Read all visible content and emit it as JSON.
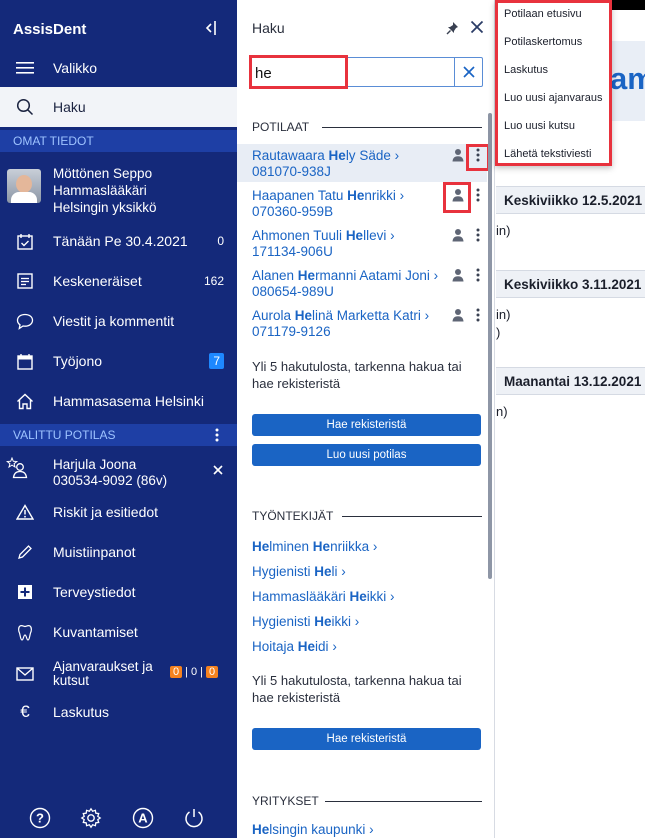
{
  "app": {
    "name": "AssisDent"
  },
  "sidebar": {
    "menu_label": "Valikko",
    "search_label": "Haku",
    "section_own": "OMAT TIEDOT",
    "user": {
      "name": "Möttönen Seppo",
      "role": "Hammaslääkäri",
      "unit": "Helsingin yksikkö"
    },
    "items": [
      {
        "label": "Tänään Pe 30.4.2021",
        "count": "0"
      },
      {
        "label": "Keskeneräiset",
        "count": "162"
      },
      {
        "label": "Viestit ja kommentit",
        "count": ""
      },
      {
        "label": "Työjono",
        "count": "7"
      },
      {
        "label": "Hammasasema Helsinki",
        "count": ""
      }
    ],
    "section_patient": "VALITTU POTILAS",
    "patient": {
      "name": "Harjula Joona",
      "ssn": "030534-9092 (86v)"
    },
    "patient_items": [
      {
        "label": "Riskit ja esitiedot"
      },
      {
        "label": "Muistiinpanot"
      },
      {
        "label": "Terveystiedot"
      },
      {
        "label": "Kuvantamiset"
      },
      {
        "label_line1": "Ajanvaraukset ja",
        "label_line2": "kutsut",
        "badges": [
          "0",
          "0",
          "0"
        ]
      },
      {
        "label": "Laskutus"
      }
    ]
  },
  "search": {
    "title": "Haku",
    "query": "he",
    "patients_header": "POTILAAT",
    "patients": [
      {
        "pre": "Rautawaara ",
        "hl": "He",
        "post": "ly Säde",
        "ssn": "081070-938J"
      },
      {
        "pre": "Haapanen Tatu ",
        "hl": "He",
        "post": "nrikki",
        "ssn": "070360-959B"
      },
      {
        "pre": "Ahmonen Tuuli ",
        "hl": "He",
        "post": "llevi",
        "ssn": "171134-906U"
      },
      {
        "pre": "Alanen ",
        "hl": "He",
        "post": "rmanni Aatami Joni",
        "ssn": "080654-989U"
      },
      {
        "pre": "Aurola ",
        "hl": "He",
        "post": "linä Marketta Katri",
        "ssn": "071179-9126"
      }
    ],
    "more_results_text": "Yli 5 hakutulosta, tarkenna hakua tai hae rekisteristä",
    "search_registry_btn": "Hae rekisteristä",
    "new_patient_btn": "Luo uusi potilas",
    "employees_header": "TYÖNTEKIJÄT",
    "employees": [
      {
        "a": "",
        "b": "He",
        "c": "lminen ",
        "d": "He",
        "e": "nriikka"
      },
      {
        "a": "Hygienisti ",
        "b": "He",
        "c": "li",
        "d": "",
        "e": ""
      },
      {
        "a": "Hammaslääkäri ",
        "b": "He",
        "c": "ikki",
        "d": "",
        "e": ""
      },
      {
        "a": "Hygienisti ",
        "b": "He",
        "c": "ikki",
        "d": "",
        "e": ""
      },
      {
        "a": "Hoitaja ",
        "b": "He",
        "c": "idi",
        "d": "",
        "e": ""
      }
    ],
    "more_results_text_2": "Yli 5 hakutulosta, tarkenna hakua tai hae rekisteristä",
    "search_registry_btn_2": "Hae rekisteristä",
    "companies_header": "YRITYKSET",
    "companies": [
      {
        "pre": "",
        "hl": "He",
        "post": "lsingin kaupunki"
      }
    ]
  },
  "context_menu": {
    "items": [
      "Potilaan etusivu",
      "Potilaskertomus",
      "Laskutus",
      "Luo uusi ajanvaraus",
      "Luo uusi kutsu",
      "Lähetä tekstiviesti"
    ]
  },
  "calendar": {
    "banner": "am",
    "days": [
      {
        "label": "Keskiviikko 12.5.2021",
        "note": "in)"
      },
      {
        "label": "Keskiviikko 3.11.2021",
        "note": "in)",
        "note2": ")"
      },
      {
        "label": "Maanantai 13.12.2021",
        "note": "n)"
      }
    ]
  },
  "colors": {
    "sidebar": "#14297a",
    "section": "#1e3fa5",
    "link": "#1a64c4",
    "highlight_box": "#e8323d",
    "badge_blue": "#1e88ff",
    "badge_orange": "#f5821f"
  }
}
